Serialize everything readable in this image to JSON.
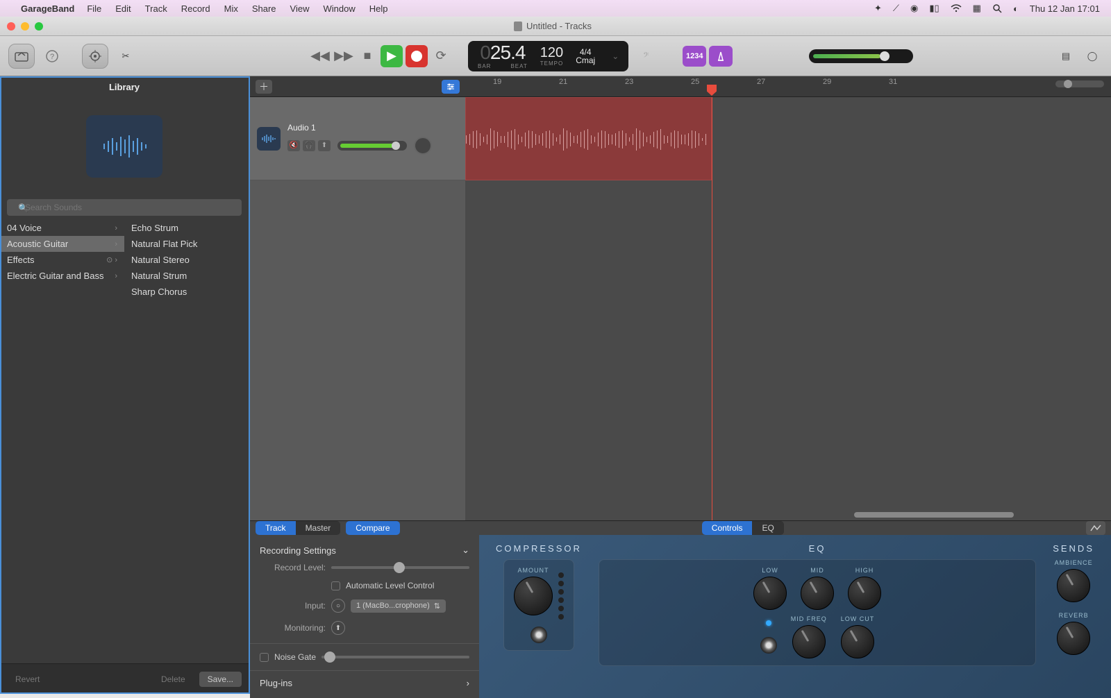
{
  "menubar": {
    "app": "GarageBand",
    "items": [
      "File",
      "Edit",
      "Track",
      "Record",
      "Mix",
      "Share",
      "View",
      "Window",
      "Help"
    ],
    "clock": "Thu 12 Jan  17:01"
  },
  "window": {
    "title": "Untitled - Tracks"
  },
  "lcd": {
    "position_dim": "0",
    "position": "25.4",
    "bar_label": "BAR",
    "beat_label": "BEAT",
    "tempo": "120",
    "tempo_label": "TEMPO",
    "sig": "4/4",
    "key": "Cmaj"
  },
  "mode": {
    "count": "1234"
  },
  "library": {
    "title": "Library",
    "search_placeholder": "Search Sounds",
    "categories": [
      {
        "label": "04 Voice",
        "has_children": true
      },
      {
        "label": "Acoustic Guitar",
        "has_children": true,
        "selected": true
      },
      {
        "label": "Effects",
        "has_children": true,
        "download": true
      },
      {
        "label": "Electric Guitar and Bass",
        "has_children": true
      }
    ],
    "presets": [
      "Echo Strum",
      "Natural Flat Pick",
      "Natural Stereo",
      "Natural Strum",
      "Sharp Chorus"
    ],
    "footer": {
      "revert": "Revert",
      "delete": "Delete",
      "save": "Save..."
    }
  },
  "ruler": {
    "bars": [
      19,
      21,
      23,
      25,
      27,
      29,
      31
    ]
  },
  "track": {
    "name": "Audio 1"
  },
  "editor_tabs": {
    "left": [
      "Track",
      "Master",
      "Compare"
    ],
    "left_active": [
      "Track",
      "Compare"
    ],
    "center": [
      "Controls",
      "EQ"
    ],
    "center_active": "Controls"
  },
  "recording": {
    "title": "Recording Settings",
    "record_level": "Record Level:",
    "auto_level": "Automatic Level Control",
    "input_label": "Input:",
    "input_value": "1 (MacBo...crophone)",
    "monitoring": "Monitoring:",
    "noise_gate": "Noise Gate",
    "plugins": "Plug-ins"
  },
  "fx": {
    "compressor": {
      "title": "COMPRESSOR",
      "amount": "AMOUNT"
    },
    "eq": {
      "title": "EQ",
      "low": "LOW",
      "mid": "MID",
      "high": "HIGH",
      "midfreq": "MID FREQ",
      "lowcut": "LOW CUT"
    },
    "sends": {
      "title": "SENDS",
      "ambience": "AMBIENCE",
      "reverb": "REVERB"
    }
  }
}
